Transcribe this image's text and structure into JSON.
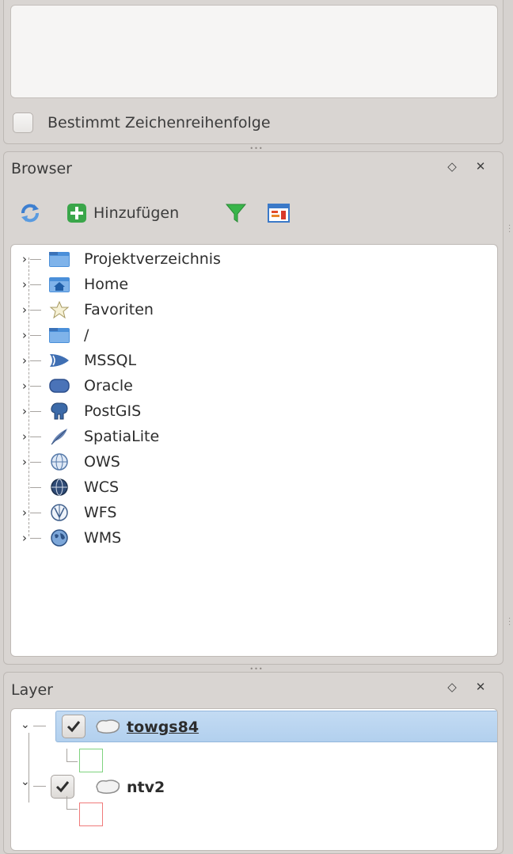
{
  "layer_order": {
    "checkbox_label": "Bestimmt Zeichenreihenfolge",
    "checked": false
  },
  "browser": {
    "title": "Browser",
    "toolbar": {
      "refresh_icon": "refresh-icon",
      "add_label": "Hinzufügen",
      "filter_icon": "filter-icon",
      "collapse_icon": "collapse-all-icon"
    },
    "items": [
      {
        "label": "Projektverzeichnis",
        "icon": "folder-icon",
        "expandable": true
      },
      {
        "label": "Home",
        "icon": "home-folder-icon",
        "expandable": true
      },
      {
        "label": "Favoriten",
        "icon": "star-icon",
        "expandable": true
      },
      {
        "label": "/",
        "icon": "folder-icon",
        "expandable": true
      },
      {
        "label": "MSSQL",
        "icon": "mssql-icon",
        "expandable": true
      },
      {
        "label": "Oracle",
        "icon": "oracle-icon",
        "expandable": true
      },
      {
        "label": "PostGIS",
        "icon": "postgis-elephant-icon",
        "expandable": true
      },
      {
        "label": "SpatiaLite",
        "icon": "spatialite-feather-icon",
        "expandable": true
      },
      {
        "label": "OWS",
        "icon": "globe-icon",
        "expandable": true
      },
      {
        "label": "WCS",
        "icon": "wcs-globe-icon",
        "expandable": false
      },
      {
        "label": "WFS",
        "icon": "wfs-globe-icon",
        "expandable": true
      },
      {
        "label": "WMS",
        "icon": "wms-globe-icon",
        "expandable": true
      }
    ]
  },
  "layers": {
    "title": "Layer",
    "items": [
      {
        "name": "towgs84",
        "checked": true,
        "selected": true,
        "legend_color": "#7fd37f"
      },
      {
        "name": "ntv2",
        "checked": true,
        "selected": false,
        "legend_color": "#f07a7a"
      }
    ]
  },
  "dock_buttons": {
    "float_icon": "float-icon",
    "close_icon": "close-icon",
    "float_glyph": "◇",
    "close_glyph": "✕"
  },
  "colors": {
    "accent_selection": "#b8d5f0",
    "add_green": "#3aa64a"
  }
}
